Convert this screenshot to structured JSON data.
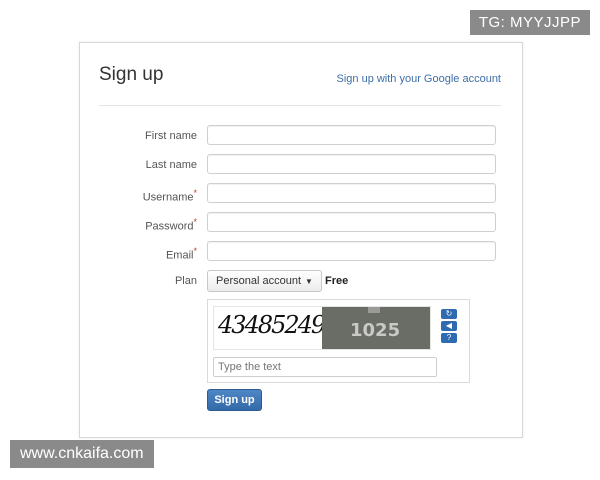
{
  "watermarks": {
    "top": "TG: MYYJJPP",
    "bottom": "www.cnkaifa.com"
  },
  "form": {
    "title": "Sign up",
    "google_link": "Sign up with your Google account",
    "fields": [
      {
        "label": "First name",
        "required": false,
        "value": ""
      },
      {
        "label": "Last name",
        "required": false,
        "value": ""
      },
      {
        "label": "Username",
        "required": true,
        "value": ""
      },
      {
        "label": "Password",
        "required": true,
        "value": ""
      },
      {
        "label": "Email",
        "required": true,
        "value": ""
      }
    ],
    "required_marker": "*",
    "plan": {
      "label": "Plan",
      "selected": "Personal account",
      "price": "Free"
    },
    "captcha": {
      "text_image": "43485249",
      "photo_number": "1025",
      "controls": [
        "refresh-icon",
        "audio-icon",
        "help-icon"
      ],
      "input_placeholder": "Type the text"
    },
    "submit_label": "Sign up"
  }
}
